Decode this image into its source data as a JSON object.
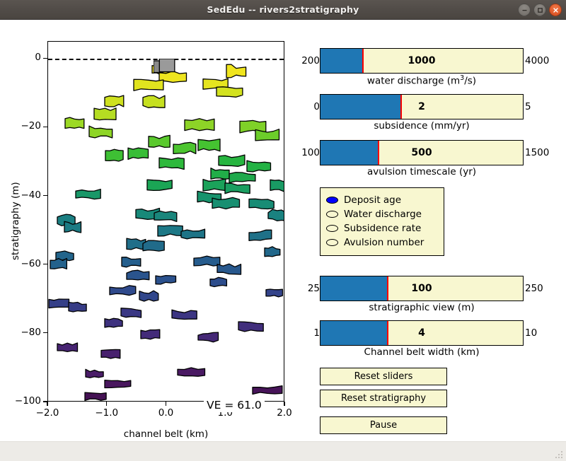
{
  "window": {
    "title": "SedEdu -- rivers2stratigraphy",
    "controls": [
      {
        "name": "minimize",
        "glyph": "minus"
      },
      {
        "name": "maximize",
        "glyph": "square"
      },
      {
        "name": "close",
        "glyph": "cross"
      }
    ]
  },
  "plot": {
    "ylabel": "stratigraphy (m)",
    "xlabel": "channel belt (km)",
    "yticks": [
      "0",
      "-20",
      "-40",
      "-60",
      "-80",
      "-100"
    ],
    "ytick_values": [
      0,
      -20,
      -40,
      -60,
      -80,
      -100
    ],
    "xticks": [
      "-2.0",
      "-1.0",
      "0.0",
      "1.0",
      "2.0"
    ],
    "xtick_values": [
      -2.0,
      -1.0,
      0.0,
      1.0,
      2.0
    ],
    "ylim": [
      -100,
      5
    ],
    "xlim": [
      -2.0,
      2.0
    ],
    "annotation": "VE = 61.0",
    "sea_level_line": 0
  },
  "chart_data": {
    "type": "scatter",
    "title": "",
    "xlabel": "channel belt (km)",
    "ylabel": "stratigraphy (m)",
    "xlim": [
      -2.0,
      2.0
    ],
    "ylim": [
      -100,
      5
    ],
    "colormap": "viridis",
    "annotation": "VE = 61.0",
    "active_channel": {
      "x": 0.02,
      "y": -1.6,
      "width": 0.33,
      "height": 3.4,
      "color": "#808080"
    },
    "deposits": [
      {
        "x": -0.09,
        "y": -3.0,
        "w": 0.3,
        "h": 3.6,
        "color": "#f5e61d"
      },
      {
        "x": 0.1,
        "y": -5.2,
        "w": 0.46,
        "h": 3.4,
        "color": "#eee51f"
      },
      {
        "x": -0.31,
        "y": -7.8,
        "w": 0.5,
        "h": 3.6,
        "color": "#e1e41f"
      },
      {
        "x": 1.17,
        "y": -3.5,
        "w": 0.33,
        "h": 4.0,
        "color": "#f0e51e"
      },
      {
        "x": 0.82,
        "y": -7.4,
        "w": 0.42,
        "h": 3.7,
        "color": "#e6e51f"
      },
      {
        "x": 1.06,
        "y": -9.6,
        "w": 0.44,
        "h": 3.5,
        "color": "#d3e21f"
      },
      {
        "x": -0.21,
        "y": -12.5,
        "w": 0.37,
        "h": 3.7,
        "color": "#c6e020"
      },
      {
        "x": -0.88,
        "y": -12.2,
        "w": 0.32,
        "h": 3.8,
        "color": "#cfe11f"
      },
      {
        "x": -1.04,
        "y": -16.0,
        "w": 0.37,
        "h": 3.9,
        "color": "#b5dd22"
      },
      {
        "x": -1.55,
        "y": -18.6,
        "w": 0.32,
        "h": 3.6,
        "color": "#9cd925"
      },
      {
        "x": -1.11,
        "y": -21.2,
        "w": 0.39,
        "h": 3.6,
        "color": "#8ed526"
      },
      {
        "x": 0.55,
        "y": -19.0,
        "w": 0.5,
        "h": 3.9,
        "color": "#8dd427"
      },
      {
        "x": 1.46,
        "y": -19.6,
        "w": 0.44,
        "h": 3.7,
        "color": "#7fd128"
      },
      {
        "x": 1.7,
        "y": -22.1,
        "w": 0.4,
        "h": 3.6,
        "color": "#6ccd2a"
      },
      {
        "x": -0.12,
        "y": -24.0,
        "w": 0.36,
        "h": 3.7,
        "color": "#5ac92d"
      },
      {
        "x": 0.3,
        "y": -25.8,
        "w": 0.38,
        "h": 3.6,
        "color": "#4cc52f"
      },
      {
        "x": 0.72,
        "y": -25.0,
        "w": 0.37,
        "h": 3.7,
        "color": "#45c331"
      },
      {
        "x": -0.88,
        "y": -28.0,
        "w": 0.3,
        "h": 3.5,
        "color": "#3ec034"
      },
      {
        "x": -0.48,
        "y": -27.4,
        "w": 0.34,
        "h": 3.6,
        "color": "#38bd37"
      },
      {
        "x": 0.08,
        "y": -30.4,
        "w": 0.42,
        "h": 3.6,
        "color": "#2eb93c"
      },
      {
        "x": 1.1,
        "y": -29.6,
        "w": 0.44,
        "h": 3.6,
        "color": "#27b540"
      },
      {
        "x": 1.55,
        "y": -31.2,
        "w": 0.4,
        "h": 3.6,
        "color": "#23b244"
      },
      {
        "x": 0.9,
        "y": -33.2,
        "w": 0.31,
        "h": 3.6,
        "color": "#21ae48"
      },
      {
        "x": 1.28,
        "y": -34.5,
        "w": 0.44,
        "h": 3.5,
        "color": "#1fa94c"
      },
      {
        "x": -0.12,
        "y": -36.6,
        "w": 0.42,
        "h": 3.6,
        "color": "#1ba555"
      },
      {
        "x": 0.8,
        "y": -36.8,
        "w": 0.38,
        "h": 3.6,
        "color": "#1ba25a"
      },
      {
        "x": 1.2,
        "y": -37.6,
        "w": 0.42,
        "h": 3.5,
        "color": "#1a9e60"
      },
      {
        "x": 1.9,
        "y": -37.0,
        "w": 0.3,
        "h": 3.6,
        "color": "#199a64"
      },
      {
        "x": -1.32,
        "y": -39.4,
        "w": 0.42,
        "h": 3.4,
        "color": "#199768"
      },
      {
        "x": 0.72,
        "y": -40.2,
        "w": 0.4,
        "h": 3.5,
        "color": "#18936d"
      },
      {
        "x": 1.0,
        "y": -42.0,
        "w": 0.46,
        "h": 3.5,
        "color": "#188f71"
      },
      {
        "x": 1.6,
        "y": -42.2,
        "w": 0.42,
        "h": 3.5,
        "color": "#188c75"
      },
      {
        "x": -0.32,
        "y": -45.0,
        "w": 0.4,
        "h": 3.4,
        "color": "#188979"
      },
      {
        "x": -0.02,
        "y": -45.6,
        "w": 0.38,
        "h": 3.4,
        "color": "#1a867c"
      },
      {
        "x": 1.86,
        "y": -45.4,
        "w": 0.3,
        "h": 3.4,
        "color": "#1a8280"
      },
      {
        "x": -1.7,
        "y": -47.0,
        "w": 0.3,
        "h": 3.4,
        "color": "#1b7f82"
      },
      {
        "x": -1.58,
        "y": -49.0,
        "w": 0.28,
        "h": 3.3,
        "color": "#1c7b84"
      },
      {
        "x": 0.06,
        "y": -50.0,
        "w": 0.42,
        "h": 3.4,
        "color": "#1d7886"
      },
      {
        "x": 0.45,
        "y": -51.0,
        "w": 0.4,
        "h": 3.3,
        "color": "#1e7487"
      },
      {
        "x": 1.58,
        "y": -51.4,
        "w": 0.38,
        "h": 3.3,
        "color": "#1f7188"
      },
      {
        "x": -0.52,
        "y": -53.8,
        "w": 0.32,
        "h": 3.3,
        "color": "#206e89"
      },
      {
        "x": -0.22,
        "y": -54.6,
        "w": 0.36,
        "h": 3.3,
        "color": "#216b8a"
      },
      {
        "x": 1.78,
        "y": -56.2,
        "w": 0.26,
        "h": 3.2,
        "color": "#22688b"
      },
      {
        "x": -1.72,
        "y": -57.4,
        "w": 0.3,
        "h": 3.2,
        "color": "#23658c"
      },
      {
        "x": -1.82,
        "y": -59.6,
        "w": 0.28,
        "h": 3.2,
        "color": "#24628c"
      },
      {
        "x": -0.6,
        "y": -59.2,
        "w": 0.32,
        "h": 3.2,
        "color": "#255f8d"
      },
      {
        "x": 0.68,
        "y": -58.8,
        "w": 0.44,
        "h": 3.2,
        "color": "#265c8d"
      },
      {
        "x": 1.05,
        "y": -61.2,
        "w": 0.4,
        "h": 3.2,
        "color": "#28588d"
      },
      {
        "x": -0.48,
        "y": -63.2,
        "w": 0.38,
        "h": 3.2,
        "color": "#2a548d"
      },
      {
        "x": -0.02,
        "y": -64.0,
        "w": 0.34,
        "h": 3.1,
        "color": "#2b518d"
      },
      {
        "x": 0.88,
        "y": -65.0,
        "w": 0.28,
        "h": 3.1,
        "color": "#2d4d8c"
      },
      {
        "x": -0.74,
        "y": -67.4,
        "w": 0.44,
        "h": 3.1,
        "color": "#2f4a8c"
      },
      {
        "x": -0.3,
        "y": -69.0,
        "w": 0.32,
        "h": 3.1,
        "color": "#31468b"
      },
      {
        "x": 1.82,
        "y": -68.0,
        "w": 0.28,
        "h": 3.1,
        "color": "#33438a"
      },
      {
        "x": -1.82,
        "y": -71.2,
        "w": 0.34,
        "h": 3.0,
        "color": "#353f88"
      },
      {
        "x": -1.5,
        "y": -72.2,
        "w": 0.3,
        "h": 3.0,
        "color": "#373c86"
      },
      {
        "x": -0.6,
        "y": -74.0,
        "w": 0.34,
        "h": 3.0,
        "color": "#3a3884"
      },
      {
        "x": 0.3,
        "y": -74.6,
        "w": 0.42,
        "h": 3.0,
        "color": "#3c3582"
      },
      {
        "x": -0.9,
        "y": -77.0,
        "w": 0.3,
        "h": 2.9,
        "color": "#3e327f"
      },
      {
        "x": 1.42,
        "y": -78.0,
        "w": 0.42,
        "h": 2.9,
        "color": "#412e7c"
      },
      {
        "x": -0.28,
        "y": -80.2,
        "w": 0.32,
        "h": 2.9,
        "color": "#432b79"
      },
      {
        "x": 0.7,
        "y": -81.0,
        "w": 0.34,
        "h": 2.9,
        "color": "#452876"
      },
      {
        "x": -1.68,
        "y": -84.2,
        "w": 0.34,
        "h": 2.8,
        "color": "#472472"
      },
      {
        "x": -0.95,
        "y": -86.0,
        "w": 0.32,
        "h": 2.8,
        "color": "#48216e"
      },
      {
        "x": -1.22,
        "y": -91.6,
        "w": 0.3,
        "h": 2.7,
        "color": "#4a1d68"
      },
      {
        "x": 0.42,
        "y": -91.2,
        "w": 0.46,
        "h": 2.8,
        "color": "#4a1a63"
      },
      {
        "x": -0.82,
        "y": -94.6,
        "w": 0.44,
        "h": 2.7,
        "color": "#49175e"
      },
      {
        "x": 1.7,
        "y": -96.4,
        "w": 0.5,
        "h": 2.6,
        "color": "#471459"
      },
      {
        "x": -1.2,
        "y": -98.4,
        "w": 0.36,
        "h": 2.4,
        "color": "#451254"
      }
    ]
  },
  "sliders": [
    {
      "name": "water-discharge",
      "min_label": "200",
      "max_label": "4000",
      "value_label": "1000",
      "caption": "water discharge (m",
      "caption_sup": "3",
      "caption_tail": "/s)",
      "fill_pct": 21.0
    },
    {
      "name": "subsidence",
      "min_label": "0",
      "max_label": "5",
      "value_label": "2",
      "caption": "subsidence (mm/yr)",
      "fill_pct": 40.0
    },
    {
      "name": "avulsion-timescale",
      "min_label": "100",
      "max_label": "1500",
      "value_label": "500",
      "caption": "avulsion timescale (yr)",
      "fill_pct": 28.5
    },
    {
      "name": "stratigraphic-view",
      "min_label": "25",
      "max_label": "250",
      "value_label": "100",
      "caption": "stratigraphic view (m)",
      "fill_pct": 33.3
    },
    {
      "name": "channel-belt-width",
      "min_label": "1",
      "max_label": "10",
      "value_label": "4",
      "caption": "Channel belt width (km)",
      "fill_pct": 33.3
    }
  ],
  "legend": {
    "items": [
      {
        "label": "Deposit age",
        "selected": true,
        "color": "#0000ff"
      },
      {
        "label": "Water discharge",
        "selected": false,
        "color": "#f8f7d0"
      },
      {
        "label": "Subsidence rate",
        "selected": false,
        "color": "#f8f7d0"
      },
      {
        "label": "Avulsion number",
        "selected": false,
        "color": "#f8f7d0"
      }
    ]
  },
  "buttons": [
    {
      "name": "reset-sliders",
      "label": "Reset sliders"
    },
    {
      "name": "reset-stratigraphy",
      "label": "Reset stratigraphy"
    },
    {
      "name": "pause",
      "label": "Pause"
    }
  ],
  "colors": {
    "widget_bg": "#f8f7d0",
    "slider_fill": "#1f77b4",
    "slider_handle": "#ff0000",
    "titlebar": "#4f4a46",
    "close_button": "#d64a1b"
  }
}
